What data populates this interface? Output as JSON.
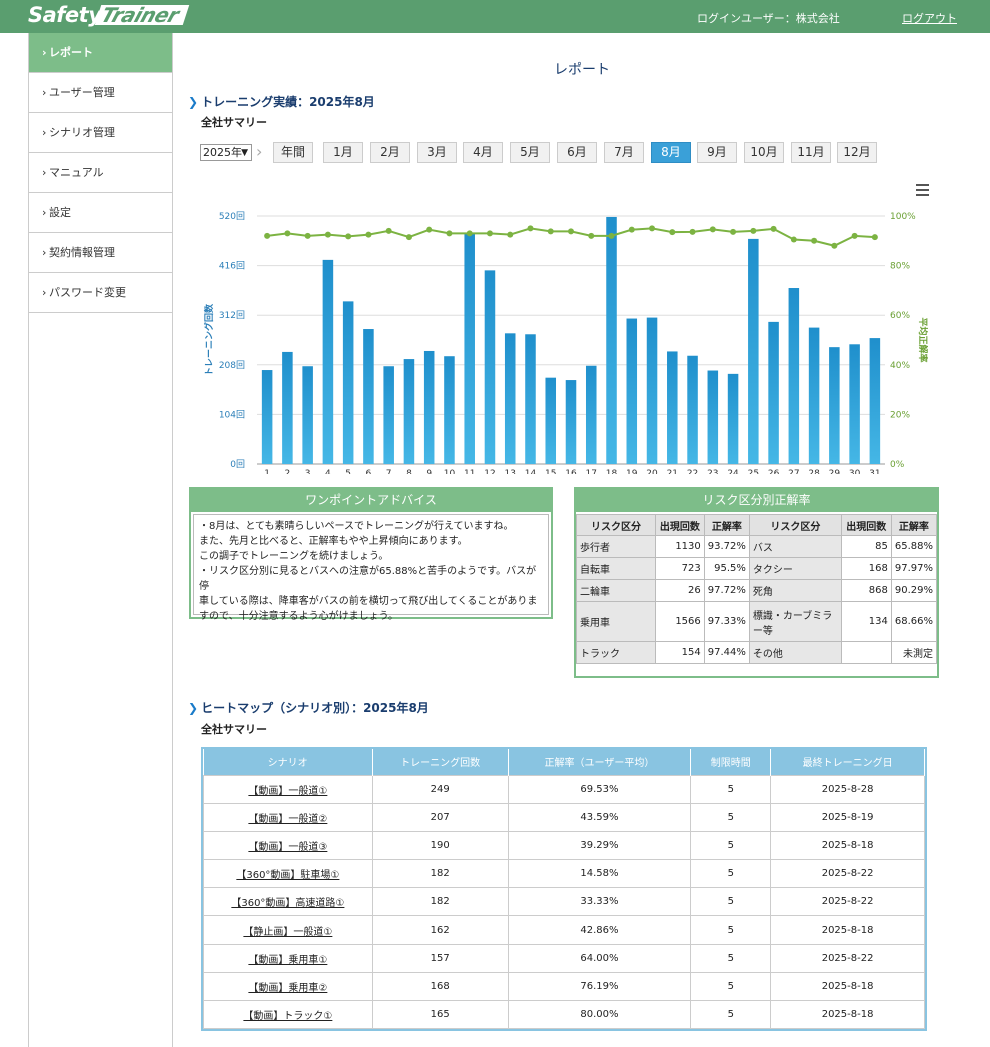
{
  "header": {
    "logo_safety": "Safety",
    "logo_trainer": "Trainer",
    "login_user": "ログインユーザー：株式会社",
    "logout": "ログアウト"
  },
  "sidebar": {
    "items": [
      {
        "label": "レポート",
        "active": true
      },
      {
        "label": "ユーザー管理"
      },
      {
        "label": "シナリオ管理"
      },
      {
        "label": "マニュアル"
      },
      {
        "label": "設定"
      },
      {
        "label": "契約情報管理"
      },
      {
        "label": "パスワード変更"
      }
    ]
  },
  "page_title": "レポート",
  "training": {
    "heading": "トレーニング実績：2025年8月",
    "subheading": "全社サマリー",
    "year": "2025年",
    "months": [
      "年間",
      "1月",
      "2月",
      "3月",
      "4月",
      "5月",
      "6月",
      "7月",
      "8月",
      "9月",
      "10月",
      "11月",
      "12月"
    ],
    "active_month": "8月"
  },
  "chart_data": {
    "type": "bar",
    "categories": [
      "1",
      "2",
      "3",
      "4",
      "5",
      "6",
      "7",
      "8",
      "9",
      "10",
      "11",
      "12",
      "13",
      "14",
      "15",
      "16",
      "17",
      "18",
      "19",
      "20",
      "21",
      "22",
      "23",
      "24",
      "25",
      "26",
      "27",
      "28",
      "29",
      "30",
      "31"
    ],
    "series": [
      {
        "name": "トレーニング回数",
        "type": "bar",
        "axis": "left",
        "values": [
          197,
          235,
          205,
          428,
          341,
          283,
          205,
          220,
          237,
          226,
          483,
          406,
          274,
          272,
          181,
          176,
          206,
          518,
          305,
          307,
          236,
          227,
          196,
          189,
          472,
          298,
          369,
          286,
          245,
          251,
          264
        ]
      },
      {
        "name": "平均正解率",
        "type": "line",
        "axis": "right",
        "values": [
          92,
          93,
          92,
          92.5,
          91.8,
          92.5,
          94,
          91.5,
          94.5,
          93,
          93,
          93,
          92.5,
          95,
          93.8,
          93.8,
          92,
          92,
          94.5,
          95,
          93.5,
          93.6,
          94.6,
          93.6,
          94,
          94.8,
          90.5,
          90,
          88,
          92,
          91.5
        ]
      }
    ],
    "left_axis": {
      "label": "トレーニング回数",
      "ticks": [
        "0回",
        "104回",
        "208回",
        "312回",
        "416回",
        "520回"
      ],
      "range": [
        0,
        520
      ]
    },
    "right_axis": {
      "label": "平均正解率",
      "ticks": [
        "0%",
        "20%",
        "40%",
        "60%",
        "80%",
        "100%"
      ],
      "range": [
        0,
        100
      ]
    },
    "legend": [
      "トレーニング回数",
      "平均正解率"
    ],
    "legend_position": "bottom",
    "grid": true,
    "colors": {
      "bar": "#2c9bd6",
      "line": "#7cb342"
    }
  },
  "advice": {
    "title": "ワンポイントアドバイス",
    "lines": [
      "・8月は、とても素晴らしいペースでトレーニングが行えていますね。",
      "また、先月と比べると、正解率もやや上昇傾向にあります。",
      "この調子でトレーニングを続けましょう。",
      "・リスク区分別に見るとバスへの注意が65.88%と苦手のようです。バスが停",
      "車している際は、降車客がバスの前を横切って飛び出してくることがありま",
      "すので、十分注意するよう心がけましょう。"
    ]
  },
  "risk": {
    "title": "リスク区分別正解率",
    "headers": [
      "リスク区分",
      "出現回数",
      "正解率",
      "リスク区分",
      "出現回数",
      "正解率"
    ],
    "rows": [
      [
        "歩行者",
        "1130",
        "93.72%",
        "バス",
        "85",
        "65.88%"
      ],
      [
        "自転車",
        "723",
        "95.5%",
        "タクシー",
        "168",
        "97.97%"
      ],
      [
        "二輪車",
        "26",
        "97.72%",
        "死角",
        "868",
        "90.29%"
      ],
      [
        "乗用車",
        "1566",
        "97.33%",
        "標識・カーブミラー等",
        "134",
        "68.66%"
      ],
      [
        "トラック",
        "154",
        "97.44%",
        "その他",
        "",
        "未測定"
      ]
    ]
  },
  "heatmap": {
    "heading": "ヒートマップ（シナリオ別）：2025年8月",
    "subheading": "全社サマリー",
    "headers": [
      "シナリオ",
      "トレーニング回数",
      "正解率（ユーザー平均）",
      "制限時間",
      "最終トレーニング日"
    ],
    "rows": [
      [
        "【動画】一般道①",
        "249",
        "69.53%",
        "5",
        "2025-8-28"
      ],
      [
        "【動画】一般道②",
        "207",
        "43.59%",
        "5",
        "2025-8-19"
      ],
      [
        "【動画】一般道③",
        "190",
        "39.29%",
        "5",
        "2025-8-18"
      ],
      [
        "【360°動画】駐車場①",
        "182",
        "14.58%",
        "5",
        "2025-8-22"
      ],
      [
        "【360°動画】高速道路①",
        "182",
        "33.33%",
        "5",
        "2025-8-22"
      ],
      [
        "【静止画】一般道①",
        "162",
        "42.86%",
        "5",
        "2025-8-18"
      ],
      [
        "【動画】乗用車①",
        "157",
        "64.00%",
        "5",
        "2025-8-22"
      ],
      [
        "【動画】乗用車②",
        "168",
        "76.19%",
        "5",
        "2025-8-18"
      ],
      [
        "【動画】トラック①",
        "165",
        "80.00%",
        "5",
        "2025-8-18"
      ]
    ]
  }
}
